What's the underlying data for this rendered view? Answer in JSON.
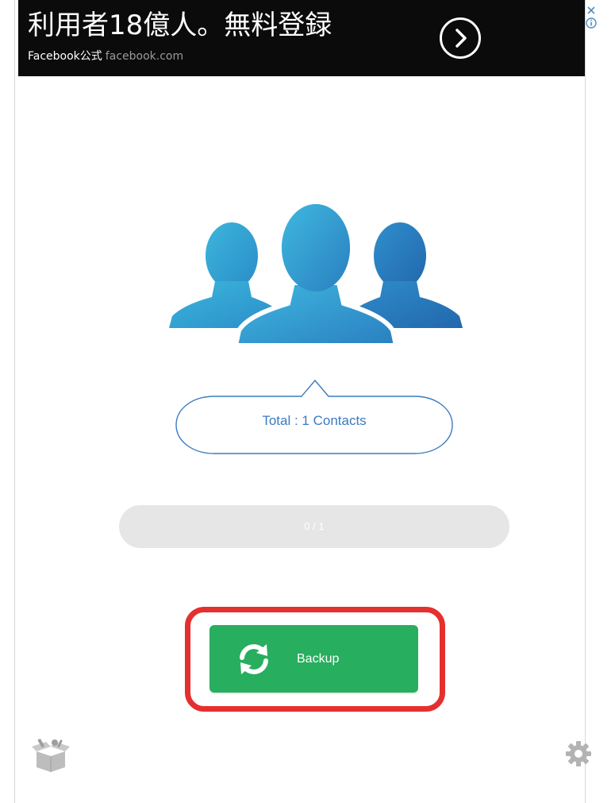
{
  "ad": {
    "headline": "利用者18億人。無料登録",
    "sponsor": "Facebook公式",
    "domain": "facebook.com",
    "arrow_icon": "chevron-right-icon",
    "close_icon": "close-icon",
    "info_icon": "info-icon"
  },
  "contacts_icon": "contacts-group-icon",
  "summary": {
    "total_label": "Total : 1 Contacts"
  },
  "progress": {
    "text": "0 / 1",
    "done": 0,
    "total": 1
  },
  "backup": {
    "label": "Backup",
    "icon": "sync-icon"
  },
  "bottom": {
    "left_icon": "box-tools-icon",
    "right_icon": "gear-icon"
  },
  "colors": {
    "accent_blue": "#3aa0d6",
    "button_green": "#27ae5e",
    "highlight_red": "#e53030",
    "ad_background": "#0b0b0b"
  }
}
